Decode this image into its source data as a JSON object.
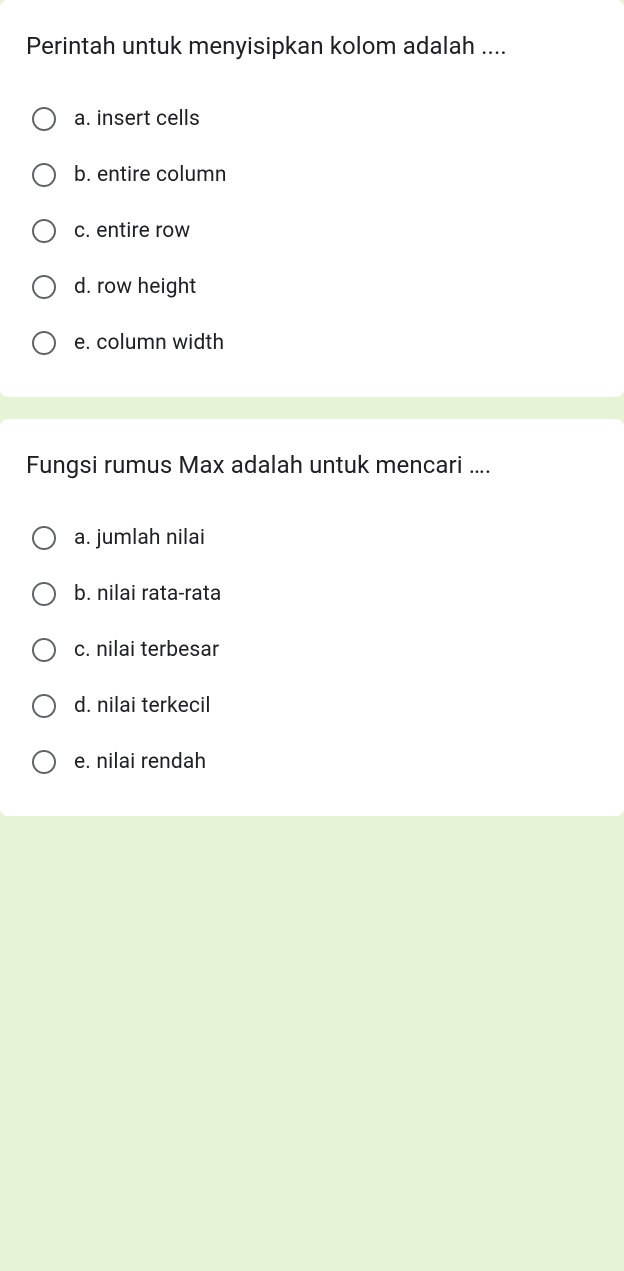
{
  "questions": [
    {
      "prompt": "Perintah untuk menyisipkan kolom adalah ....",
      "options": [
        "a. insert cells",
        "b. entire column",
        "c. entire row",
        "d. row height",
        "e. column width"
      ]
    },
    {
      "prompt": "Fungsi rumus Max adalah untuk mencari ….",
      "options": [
        "a. jumlah nilai",
        "b. nilai rata-rata",
        "c. nilai terbesar",
        "d. nilai terkecil",
        "e. nilai rendah"
      ]
    }
  ]
}
